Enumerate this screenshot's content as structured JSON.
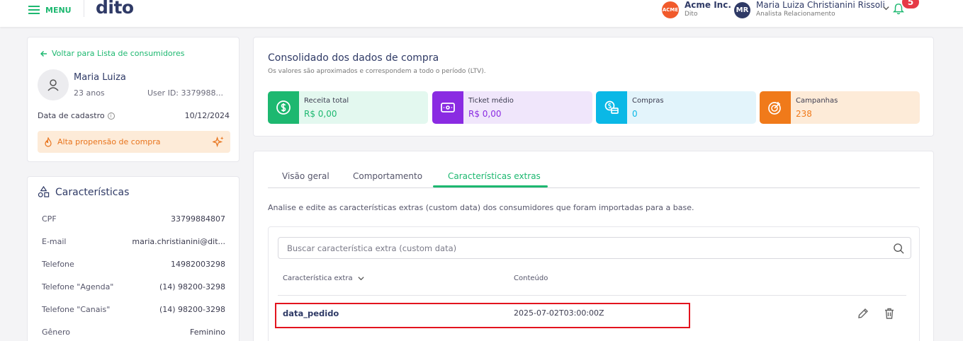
{
  "topbar": {
    "menu_label": "MENU",
    "logo": "dito",
    "company": {
      "name": "Acme Inc.",
      "sub": "Dito",
      "logo_text": "ACME"
    },
    "user": {
      "initials": "MR",
      "name": "Maria Luiza Christianini Rissoli",
      "role": "Analista Relacionamento"
    },
    "notifications": "5"
  },
  "profile": {
    "back_label": "Voltar para Lista de consumidores",
    "name": "Maria Luiza",
    "age": "23 anos",
    "user_id": "User ID: 3379988...",
    "reg_label": "Data de cadastro",
    "reg_date": "10/12/2024",
    "propensity": "Alta propensão de compra"
  },
  "characteristics": {
    "title": "Características",
    "rows": [
      {
        "k": "CPF",
        "v": "33799884807"
      },
      {
        "k": "E-mail",
        "v": "maria.christianini@dit..."
      },
      {
        "k": "Telefone",
        "v": "14982003298"
      },
      {
        "k": "Telefone \"Agenda\"",
        "v": "(14) 98200-3298"
      },
      {
        "k": "Telefone \"Canais\"",
        "v": "(14) 98200-3298"
      },
      {
        "k": "Gênero",
        "v": "Feminino"
      }
    ]
  },
  "purchase": {
    "title": "Consolidado dos dados de compra",
    "subtitle": "Os valores são aproximados e correspondem a todo o período (LTV).",
    "metrics": [
      {
        "label": "Receita total",
        "value": "R$ 0,00",
        "color": "#1db870",
        "bg": "#e3f8ef",
        "icon": "dollar-icon"
      },
      {
        "label": "Ticket médio",
        "value": "R$ 0,00",
        "color": "#8a2be2",
        "bg": "#f0e6fb",
        "icon": "ticket-icon"
      },
      {
        "label": "Compras",
        "value": "0",
        "color": "#0ab8e6",
        "bg": "#e3f4fb",
        "icon": "coins-icon"
      },
      {
        "label": "Campanhas",
        "value": "238",
        "color": "#f07a1a",
        "bg": "#fdebd8",
        "icon": "target-icon"
      }
    ]
  },
  "tabs": {
    "items": [
      "Visão geral",
      "Comportamento",
      "Características extras"
    ],
    "active": "Características extras",
    "description": "Analise e edite as características extras (custom data) dos consumidores que foram importadas para a base."
  },
  "table": {
    "search_placeholder": "Buscar característica extra (custom data)",
    "col1": "Característica extra",
    "col2": "Conteúdo",
    "rows": [
      {
        "name": "data_pedido",
        "value": "2025-07-02T03:00:00Z"
      }
    ]
  }
}
